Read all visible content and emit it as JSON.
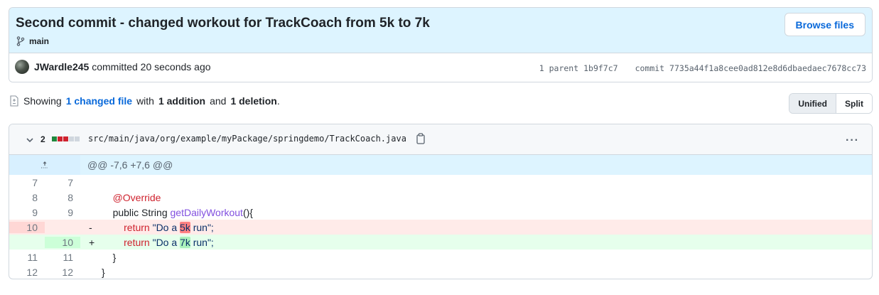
{
  "commit": {
    "title": "Second commit - changed workout for TrackCoach from 5k to 7k",
    "branch": "main",
    "browse_label": "Browse files",
    "author": "JWardle245",
    "action": "committed",
    "time": "20 seconds ago",
    "parent_label": "1 parent",
    "parent_sha": "1b9f7c7",
    "commit_label": "commit",
    "commit_sha": "7735a44f1a8cee0ad812e8d6dbaedaec7678cc73"
  },
  "summary": {
    "prefix": "Showing",
    "changed_files": "1 changed file",
    "with": "with",
    "additions": "1 addition",
    "and": "and",
    "deletions": "1 deletion",
    "suffix": "."
  },
  "view_toggle": {
    "unified": "Unified",
    "split": "Split",
    "active": "Unified"
  },
  "file": {
    "change_count": "2",
    "path": "src/main/java/org/example/myPackage/springdemo/TrackCoach.java",
    "diffstat_colors": [
      "#1f883d",
      "#cf222e",
      "#cf222e",
      "#d0d7de",
      "#d0d7de"
    ],
    "hunk_header": "@@ -7,6 +7,6 @@",
    "lines": [
      {
        "old": "7",
        "new": "7",
        "sign": "",
        "code": ""
      },
      {
        "old": "8",
        "new": "8",
        "sign": "",
        "code": "    @Override"
      },
      {
        "old": "9",
        "new": "9",
        "sign": "",
        "code": "    public String getDailyWorkout(){"
      },
      {
        "old": "10",
        "new": "",
        "sign": "-",
        "code": "        return \"Do a 5k run\";"
      },
      {
        "old": "",
        "new": "10",
        "sign": "+",
        "code": "        return \"Do a 7k run\";"
      },
      {
        "old": "11",
        "new": "11",
        "sign": "",
        "code": "    }"
      },
      {
        "old": "12",
        "new": "12",
        "sign": "",
        "code": "}"
      }
    ]
  },
  "code_tokens": {
    "annotation": "@Override",
    "public": "public String ",
    "method": "getDailyWorkout",
    "method_tail": "(){",
    "return_kw": "return ",
    "str_del_a": "\"Do a ",
    "str_del_hl": "5k",
    "str_del_b": " run\";",
    "str_add_a": "\"Do a ",
    "str_add_hl": "7k",
    "str_add_b": " run\";",
    "close_brace_inner": "}",
    "close_brace_outer": "}"
  }
}
